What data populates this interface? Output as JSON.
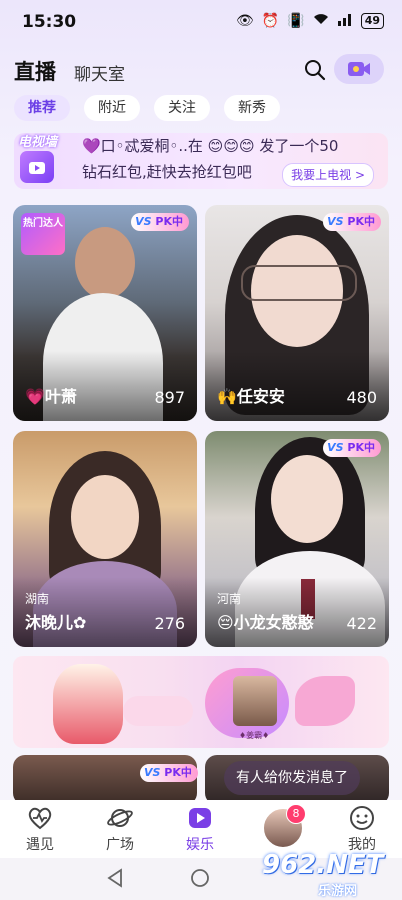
{
  "status_bar": {
    "time": "15:30",
    "battery": "49"
  },
  "header": {
    "live_tab": "直播",
    "chat_tab": "聊天室"
  },
  "chips": [
    "推荐",
    "附近",
    "关注",
    "新秀"
  ],
  "banner": {
    "tag": "电视墙",
    "line1": "💜口◦忒爱桐◦..在 😊😊😊 发了一个50",
    "line2": "钻石红包,赶快去抢红包吧",
    "button": "我要上电视 >"
  },
  "cards": [
    {
      "name": "💗叶萧",
      "count": "897",
      "badge": "热门达人",
      "pk": "PK中"
    },
    {
      "name": "🙌任安安",
      "count": "480",
      "pk": "PK中"
    },
    {
      "name": "沐晚儿✿",
      "count": "276",
      "city": "湖南"
    },
    {
      "name": "😔小龙女憨憨",
      "count": "422",
      "city": "河南",
      "pk": "PK中"
    },
    {
      "pk": "PK中"
    }
  ],
  "pk_vs": "VS",
  "wide_banner": {
    "label": "♦姜霸♦"
  },
  "toast": "有人给你发消息了",
  "tabbar": {
    "items": [
      {
        "label": "遇见"
      },
      {
        "label": "广场"
      },
      {
        "label": "娱乐"
      },
      {
        "label": "我的"
      }
    ],
    "message_count": "8"
  },
  "watermark": {
    "main": "962.NET",
    "sub": "乐游网"
  },
  "colors": {
    "accent": "#7a3fe6",
    "badge": "#ff3d6e"
  }
}
